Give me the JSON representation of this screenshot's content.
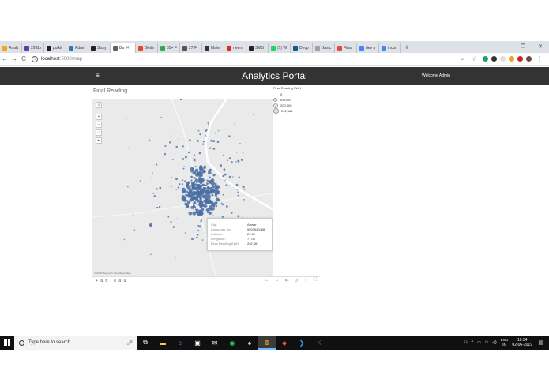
{
  "browser": {
    "tabs": [
      {
        "label": "Analy",
        "color": "#f4a61c"
      },
      {
        "label": "29 Bo",
        "color": "#5b3fa8"
      },
      {
        "label": "pulkit",
        "color": "#222222"
      },
      {
        "label": "Admi",
        "color": "#3776ab"
      },
      {
        "label": "Story",
        "color": "#222222"
      },
      {
        "label": "Ba",
        "color": "#5f6368",
        "active": true
      },
      {
        "label": "Gettir",
        "color": "#e8462b"
      },
      {
        "label": "55+ F",
        "color": "#2fa84f"
      },
      {
        "label": "27 Fr",
        "color": "#555555"
      },
      {
        "label": "Mater",
        "color": "#333333"
      },
      {
        "label": "neem",
        "color": "#d93025"
      },
      {
        "label": "SMS",
        "color": "#222222"
      },
      {
        "label": "(1) W",
        "color": "#25d366"
      },
      {
        "label": "Devp",
        "color": "#0e5a8a"
      },
      {
        "label": "Basic",
        "color": "#a0a0a0"
      },
      {
        "label": "Final",
        "color": "#e24a4a"
      },
      {
        "label": "dev p",
        "color": "#4285f4"
      },
      {
        "label": "incon",
        "color": "#4285f4"
      }
    ],
    "new_tab_label": "+",
    "window_controls": {
      "minimize": "–",
      "maximize": "❐",
      "close": "✕"
    },
    "address": {
      "host": "localhost",
      "path": ":5000/map"
    },
    "nav_icons": [
      "back-icon",
      "forward-icon",
      "reload-icon"
    ]
  },
  "app": {
    "menu_icon": "≡",
    "title": "Analytics Portal",
    "welcome": "Welcome Admin"
  },
  "dashboard": {
    "title": "Final Reading",
    "map_controls": [
      "⌕",
      "+",
      "−",
      "⌂",
      "▸"
    ],
    "attribution": "© 2018 Mapbox © OpenStreetMap",
    "legend": {
      "title": "Final Reading KWH",
      "items": [
        "0",
        "100,000",
        "200,000",
        "292,661"
      ]
    },
    "tooltip": [
      {
        "key": "City:",
        "value": "Amsar"
      },
      {
        "key": "Consumer No:",
        "value": "5903940486"
      },
      {
        "key": "Latitude:",
        "value": "29.66"
      },
      {
        "key": "Longitude:",
        "value": "77.00"
      },
      {
        "key": "Final Reading KWH:",
        "value": "292,661"
      }
    ],
    "footer_logo": "+ a b l e a u",
    "footer_tools": [
      "←",
      "→",
      "⇤",
      "↺",
      "⇪",
      "⛶"
    ]
  },
  "taskbar": {
    "search_placeholder": "Type here to search",
    "apps": [
      "task-view-icon",
      "file-explorer-icon",
      "edge-icon",
      "store-icon",
      "mail-icon",
      "spotify-icon",
      "solitaire-icon",
      "chrome-icon",
      "git-icon",
      "vscode-icon",
      "excel-icon"
    ],
    "language": "ENG",
    "region": "IN",
    "time": "10:34",
    "date": "02-06-2019"
  }
}
